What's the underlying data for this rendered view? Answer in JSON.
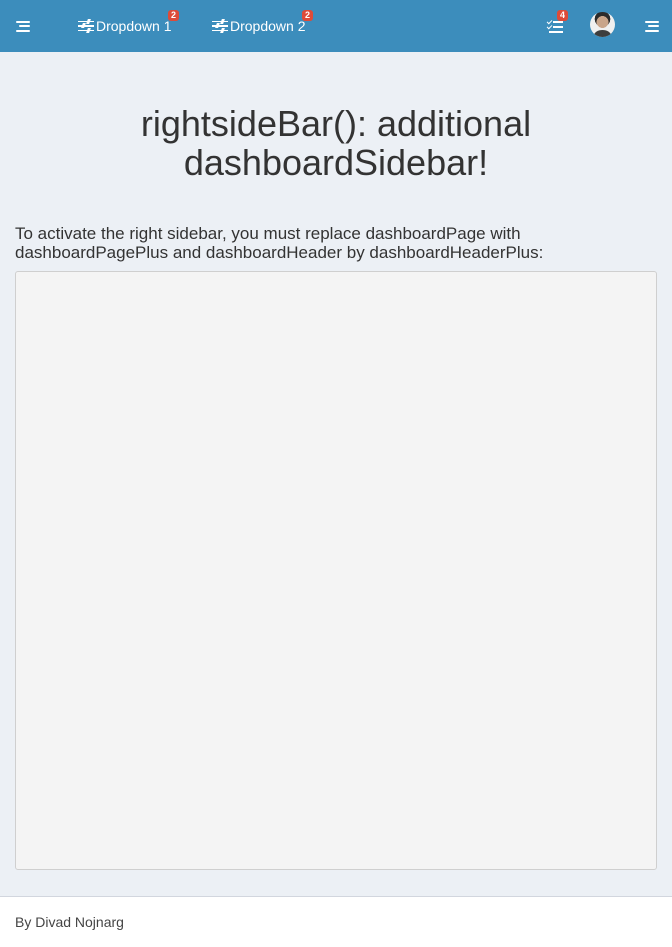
{
  "header": {
    "background_color": "#3c8dbc",
    "left_toggle_icon": "hamburger-icon",
    "dropdowns": [
      {
        "label": "Dropdown 1",
        "icon": "sliders-icon",
        "badge": "2"
      },
      {
        "label": "Dropdown 2",
        "icon": "sliders-icon",
        "badge": "2"
      }
    ],
    "tasks": {
      "icon": "tasks-icon",
      "badge": "4"
    },
    "user_avatar": "avatar",
    "right_toggle_icon": "hamburger-icon"
  },
  "badge_color": "#dd4b39",
  "main": {
    "title": "rightsideBar(): additional dashboardSidebar!",
    "description": "To activate the right sidebar, you must replace dashboardPage with dashboardPagePlus and dashboardHeader by dashboardHeaderPlus:",
    "code": ""
  },
  "footer": {
    "text": "By Divad Nojnarg"
  }
}
